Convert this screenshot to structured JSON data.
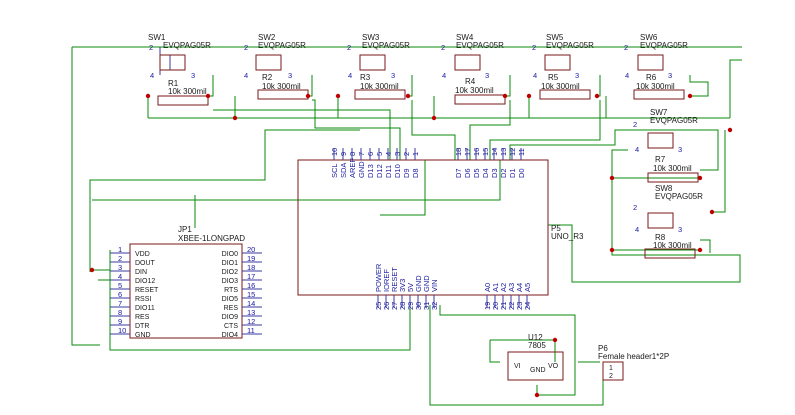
{
  "switches": [
    {
      "ref": "SW1",
      "value": "EVQPAG05R",
      "pins": [
        "2",
        "4",
        "3"
      ]
    },
    {
      "ref": "SW2",
      "value": "EVQPAG05R",
      "pins": [
        "2",
        "4",
        "3"
      ]
    },
    {
      "ref": "SW3",
      "value": "EVQPAG05R",
      "pins": [
        "2",
        "4",
        "3"
      ]
    },
    {
      "ref": "SW4",
      "value": "EVQPAG05R",
      "pins": [
        "2",
        "4",
        "3"
      ]
    },
    {
      "ref": "SW5",
      "value": "EVQPAG05R",
      "pins": [
        "2",
        "4",
        "3"
      ]
    },
    {
      "ref": "SW6",
      "value": "EVQPAG05R",
      "pins": [
        "2",
        "4",
        "3"
      ]
    },
    {
      "ref": "SW7",
      "value": "EVQPAG05R",
      "pins": [
        "2",
        "4",
        "3"
      ]
    },
    {
      "ref": "SW8",
      "value": "EVQPAG05R",
      "pins": [
        "2",
        "4",
        "3"
      ]
    }
  ],
  "resistors": [
    {
      "ref": "R1",
      "value": "10k 300mil"
    },
    {
      "ref": "R2",
      "value": "10k 300mil"
    },
    {
      "ref": "R3",
      "value": "10k 300mil"
    },
    {
      "ref": "R4",
      "value": "10k 300mil"
    },
    {
      "ref": "R5",
      "value": "10k 300mil"
    },
    {
      "ref": "R6",
      "value": "10k 300mil"
    },
    {
      "ref": "R7",
      "value": "10k 300mil"
    },
    {
      "ref": "R8",
      "value": "10k 300mil"
    }
  ],
  "uno": {
    "ref": "P5",
    "value": "UNO_R3",
    "top_pin_numbers": [
      "10",
      "9",
      "8",
      "7",
      "6",
      "5",
      "4",
      "3",
      "2",
      "1",
      "18",
      "17",
      "16",
      "15",
      "14",
      "13",
      "12",
      "11"
    ],
    "top_pin_names": [
      "SCL",
      "SDA",
      "AREF",
      "GND",
      "D13",
      "D12",
      "D11",
      "D10",
      "D9",
      "D8",
      "D7",
      "D6",
      "D5",
      "D4",
      "D3",
      "D2",
      "D1",
      "D0"
    ],
    "bottom_pin_numbers": [
      "25",
      "26",
      "27",
      "28",
      "29",
      "30",
      "31",
      "32",
      "19",
      "20",
      "21",
      "22",
      "23",
      "24"
    ],
    "bottom_pin_names": [
      "POWER",
      "IOREF",
      "RESET",
      "3V3",
      "5V",
      "GND",
      "GND",
      "VIN",
      "A0",
      "A1",
      "A2",
      "A3",
      "A4",
      "A5"
    ]
  },
  "xbee": {
    "ref": "JP1",
    "value": "XBEE-1LONGPAD",
    "left_pins": [
      {
        "num": "1",
        "name": "VDD"
      },
      {
        "num": "2",
        "name": "DOUT"
      },
      {
        "num": "3",
        "name": "DIN"
      },
      {
        "num": "4",
        "name": "DIO12"
      },
      {
        "num": "5",
        "name": "RESET"
      },
      {
        "num": "6",
        "name": "RSSI"
      },
      {
        "num": "7",
        "name": "DIO11"
      },
      {
        "num": "8",
        "name": "RES"
      },
      {
        "num": "9",
        "name": "DTR"
      },
      {
        "num": "10",
        "name": "GND"
      }
    ],
    "right_pins": [
      {
        "num": "20",
        "name": "DIO0"
      },
      {
        "num": "19",
        "name": "DIO1"
      },
      {
        "num": "18",
        "name": "DIO2"
      },
      {
        "num": "17",
        "name": "DIO3"
      },
      {
        "num": "16",
        "name": "RTS"
      },
      {
        "num": "15",
        "name": "DIO5"
      },
      {
        "num": "14",
        "name": "RES"
      },
      {
        "num": "13",
        "name": "DIO9"
      },
      {
        "num": "12",
        "name": "CTS"
      },
      {
        "num": "11",
        "name": "DIO4"
      }
    ]
  },
  "regulator": {
    "ref": "U12",
    "value": "7805",
    "pins": [
      "VI",
      "GND",
      "VO"
    ]
  },
  "header": {
    "ref": "P6",
    "value": "Female header1*2P",
    "pins": [
      "1",
      "2"
    ]
  },
  "colors": {
    "wire": "#0a8a0a",
    "body": "#7a1a1a",
    "pin": "#3a3aa0",
    "junction": "#c00000",
    "background": "#ffffff"
  }
}
